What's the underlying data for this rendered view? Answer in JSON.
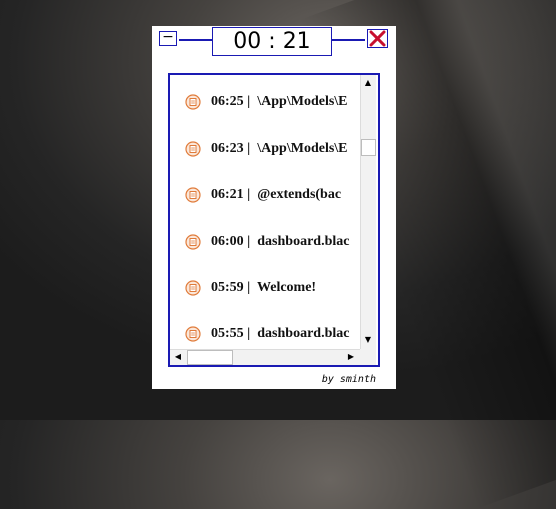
{
  "widget": {
    "minimize_label": "−",
    "timer": "00 : 21",
    "footer": "by sminth",
    "accent_color": "#1a1ab3",
    "close_color": "#c8102e"
  },
  "entries": [
    {
      "time": "06:25",
      "text": "\\App\\Models\\E"
    },
    {
      "time": "06:23",
      "text": "\\App\\Models\\E"
    },
    {
      "time": "06:21",
      "text": "@extends(bac"
    },
    {
      "time": "06:00",
      "text": "dashboard.blac"
    },
    {
      "time": "05:59",
      "text": "Welcome!"
    },
    {
      "time": "05:55",
      "text": "dashboard.blac"
    }
  ],
  "icons": {
    "entry": "clipboard-icon",
    "minimize": "minimize-icon",
    "close": "close-icon"
  }
}
